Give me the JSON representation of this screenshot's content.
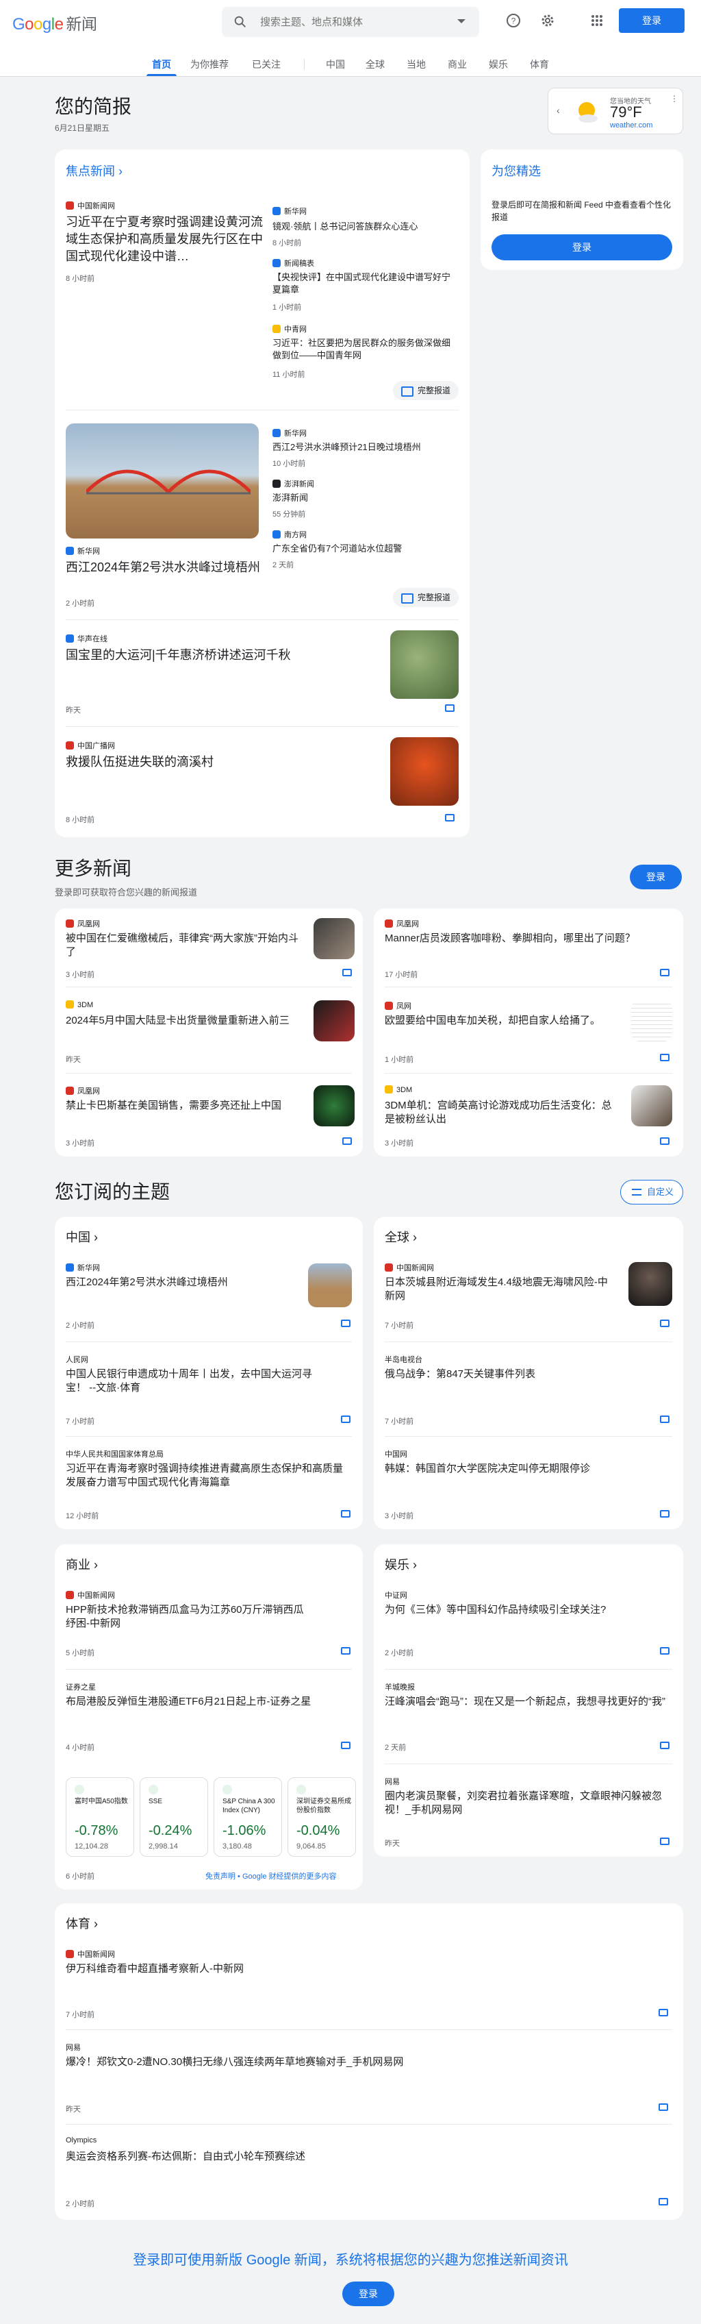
{
  "header": {
    "logo_google": "Google",
    "logo_news": "新闻",
    "search_placeholder": "搜索主题、地点和媒体",
    "signin": "登录"
  },
  "tabs": [
    "首页",
    "为你推荐",
    "已关注",
    "中国",
    "全球",
    "当地",
    "商业",
    "娱乐",
    "体育"
  ],
  "briefing": {
    "title": "您的简报",
    "date": "6月21日星期五"
  },
  "weather": {
    "label": "您当地的天气",
    "temp": "79°F",
    "source": "weather.com"
  },
  "top": {
    "title": "焦点新闻",
    "full": "完整报道",
    "s1": {
      "source": "中国新闻网",
      "title": "习近平在宁夏考察时强调建设黄河流域生态保护和高质量发展先行区在中国式现代化建设中谱…",
      "time": "8 小时前",
      "rel": [
        {
          "source": "新华网",
          "title": "镜观·领航丨总书记问答族群众心连心",
          "time": "8 小时前"
        },
        {
          "source": "新闻稿表",
          "title": "【央视快评】在中国式现代化建设中谱写好宁夏篇章",
          "time": "1 小时前"
        },
        {
          "source": "中青网",
          "title": "习近平：社区要把为居民群众的服务做深做细做到位——中国青年网",
          "time": "11 小时前"
        }
      ]
    },
    "s2": {
      "source": "新华网",
      "title": "西江2024年第2号洪水洪峰过境梧州",
      "time": "2 小时前",
      "rel": [
        {
          "source": "新华网",
          "title": "西江2号洪水洪峰预计21日晚过境梧州",
          "time": "10 小时前"
        },
        {
          "source": "澎湃新闻",
          "title": "澎湃新闻",
          "time": "55 分钟前"
        },
        {
          "source": "南方网",
          "title": "广东全省仍有7个河道站水位超警",
          "time": "2 天前"
        }
      ]
    },
    "s3": {
      "source": "华声在线",
      "title": "国宝里的大运河|千年惠济桥讲述运河千秋",
      "time": "昨天"
    },
    "s4": {
      "source": "中国广播网",
      "title": "救援队伍挺进失联的滴溪村",
      "time": "8 小时前"
    }
  },
  "picks": {
    "title": "为您精选",
    "text": "登录后即可在简报和新闻 Feed 中查看查看个性化报道",
    "btn": "登录"
  },
  "more": {
    "title": "更多新闻",
    "sub": "登录即可获取符合您兴趣的新闻报道",
    "btn": "登录",
    "items": [
      {
        "source": "凤凰网",
        "title": "被中国在仁爱礁缴械后，菲律宾“两大家族”开始内斗了",
        "time": "3 小时前"
      },
      {
        "source": "凤凰网",
        "title": "Manner店员泼顾客咖啡粉、拳脚相向，哪里出了问题？",
        "time": "17 小时前"
      },
      {
        "source": "3DM",
        "title": "2024年5月中国大陆显卡出货量微量重新进入前三",
        "time": "昨天"
      },
      {
        "source": "凤网",
        "title": "欧盟要给中国电车加关税，却把自家人给捅了。",
        "time": "1 小时前"
      },
      {
        "source": "凤凰网",
        "title": "禁止卡巴斯基在美国销售，需要多亮还扯上中国",
        "time": "3 小时前"
      },
      {
        "source": "3DM",
        "title": "3DM单机：宫崎英高讨论游戏成功后生活变化：总是被粉丝认出",
        "time": "3 小时前"
      }
    ]
  },
  "topics": {
    "title": "您订阅的主题",
    "customize": "自定义",
    "china": {
      "title": "中国",
      "items": [
        {
          "source": "新华网",
          "title": "西江2024年第2号洪水洪峰过境梧州",
          "time": "2 小时前"
        },
        {
          "source": "人民网",
          "title": "中国人民银行申遗成功十周年丨出发，去中国大运河寻宝！ --文旅·体育",
          "time": "7 小时前"
        },
        {
          "source": "中华人民共和国国家体育总局",
          "title": "习近平在青海考察时强调持续推进青藏高原生态保护和高质量发展奋力谱写中国式现代化青海篇章",
          "time": "12 小时前"
        }
      ]
    },
    "world": {
      "title": "全球",
      "items": [
        {
          "source": "中国新闻网",
          "title": "日本茨城县附近海域发生4.4级地震无海啸风险-中新网",
          "time": "7 小时前"
        },
        {
          "source": "半岛电视台",
          "title": "俄乌战争：第847天关键事件列表",
          "time": "7 小时前"
        },
        {
          "source": "中国网",
          "title": "韩媒：韩国首尔大学医院决定叫停无期限停诊",
          "time": "3 小时前"
        }
      ]
    },
    "biz": {
      "title": "商业",
      "items": [
        {
          "source": "中国新闻网",
          "title": "HPP新技术抢救滞销西瓜盒马为江苏60万斤滞销西瓜纾困-中新网",
          "time": "5 小时前"
        },
        {
          "source": "证券之星",
          "title": "布局港股反弹恒生港股通ETF6月21日起上市-证券之星",
          "time": "4 小时前"
        }
      ],
      "time": "6 小时前",
      "disclaimer": "免责声明 • Google 财经提供的更多内容",
      "stocks": [
        {
          "name": "富时中国A50指数",
          "val": "-0.78%",
          "price": "12,104.28"
        },
        {
          "name": "SSE",
          "val": "-0.24%",
          "price": "2,998.14"
        },
        {
          "name": "S&P China A 300 Index (CNY)",
          "val": "-1.06%",
          "price": "3,180.48"
        },
        {
          "name": "深圳证券交易所成份股价指数",
          "val": "-0.04%",
          "price": "9,064.85"
        }
      ]
    },
    "ent": {
      "title": "娱乐",
      "items": [
        {
          "source": "中证网",
          "title": "为何《三体》等中国科幻作品持续吸引全球关注?",
          "time": "2 小时前"
        },
        {
          "source": "羊城晚报",
          "title": "汪峰演唱会“跑马”：现在又是一个新起点，我想寻找更好的“我”",
          "time": "2 天前"
        },
        {
          "source": "网易",
          "title": "圈内老演员聚餐，刘奕君拉着张嘉译寒暄，文章眼神闪躲被忽视！_手机网易网",
          "time": "昨天"
        }
      ]
    },
    "sport": {
      "title": "体育",
      "items": [
        {
          "source": "中国新闻网",
          "title": "伊万科维奇看中超直播考察新人-中新网",
          "time": "7 小时前"
        },
        {
          "source": "网易",
          "title": "爆冷！郑钦文0-2遭NO.30横扫无缘八强连续两年草地赛输对手_手机网易网",
          "time": "昨天"
        },
        {
          "source": "Olympics",
          "title": "奥运会资格系列赛-布达佩斯：自由式小轮车预赛综述",
          "time": "2 小时前"
        }
      ]
    }
  },
  "footer": {
    "text": "登录即可使用新版 Google 新闻，系统将根据您的兴趣为您推送新闻资讯",
    "btn": "登录"
  }
}
